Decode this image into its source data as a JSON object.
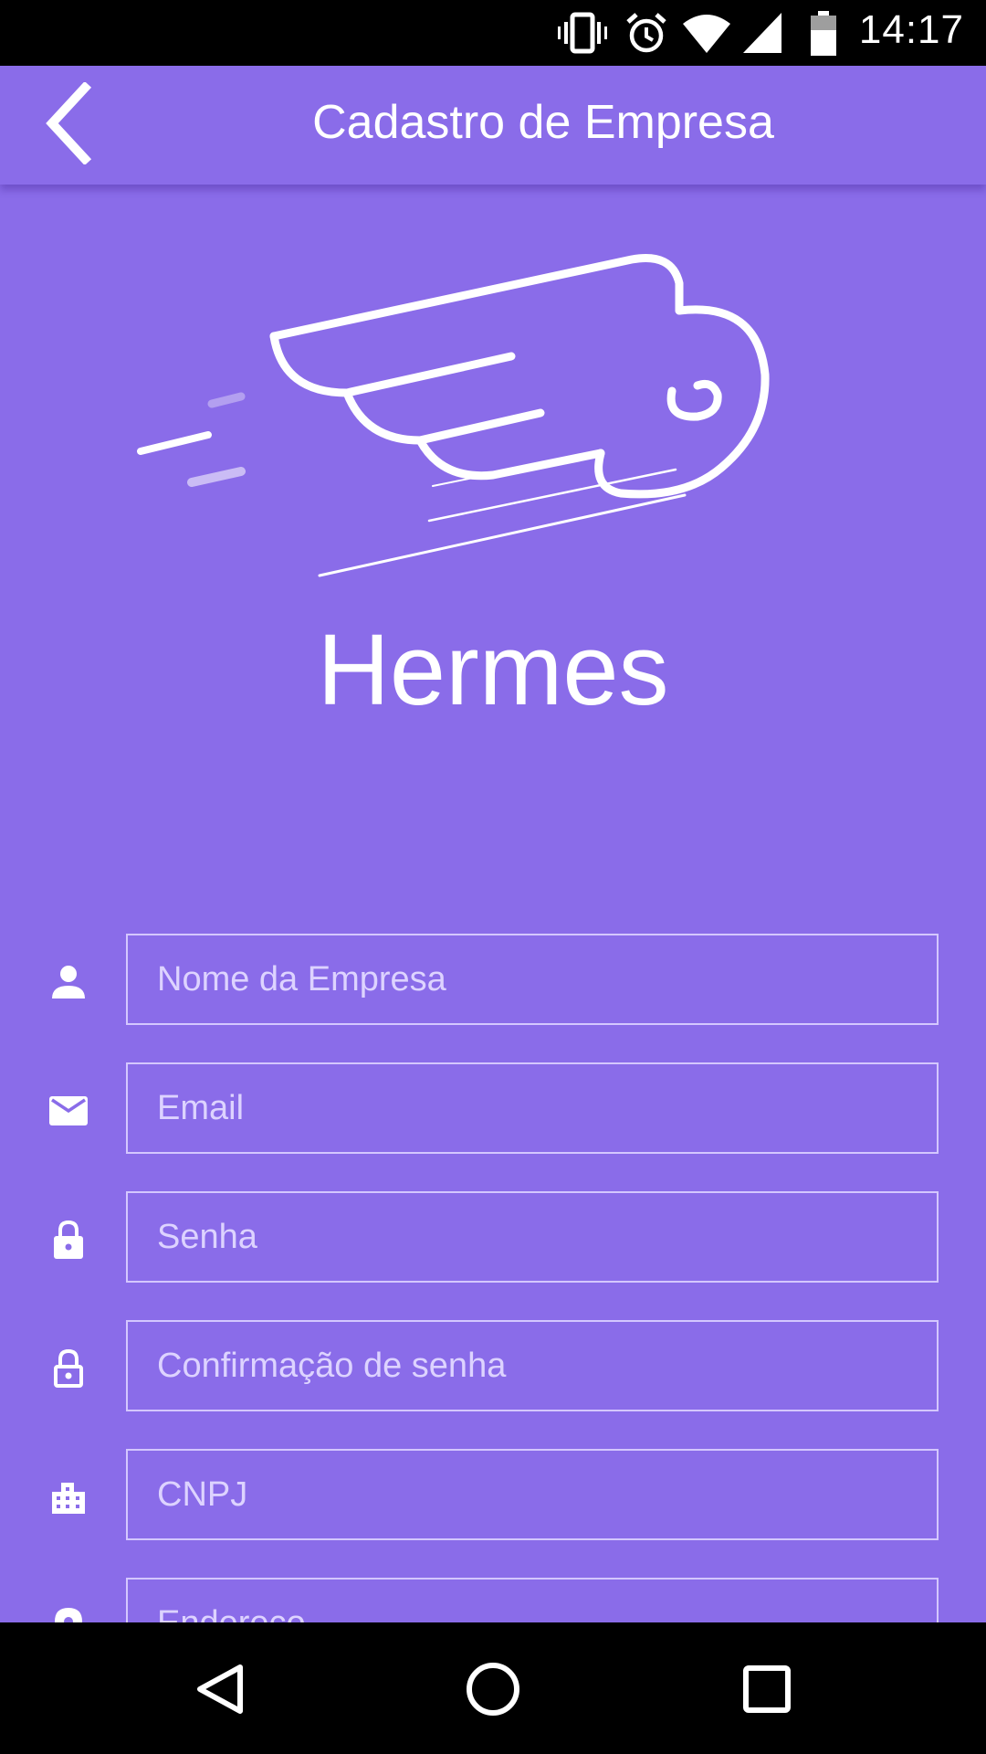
{
  "status_bar": {
    "time": "14:17",
    "icons": [
      "vibrate-icon",
      "alarm-icon",
      "wifi-icon",
      "signal-icon",
      "battery-icon"
    ]
  },
  "app_bar": {
    "title": "Cadastro de Empresa",
    "back_icon": "arrow-back-icon"
  },
  "brand": {
    "name": "Hermes",
    "logo": "winged-logo"
  },
  "form": {
    "fields": [
      {
        "icon": "person-icon",
        "placeholder": "Nome da Empresa",
        "value": ""
      },
      {
        "icon": "mail-icon",
        "placeholder": "Email",
        "value": ""
      },
      {
        "icon": "lock-icon",
        "placeholder": "Senha",
        "value": ""
      },
      {
        "icon": "lock-open-icon",
        "placeholder": "Confirmação de senha",
        "value": ""
      },
      {
        "icon": "building-icon",
        "placeholder": "CNPJ",
        "value": ""
      },
      {
        "icon": "location-pin-icon",
        "placeholder": "Endereço",
        "value": ""
      }
    ]
  },
  "nav_bar": {
    "buttons": [
      "back-triangle-icon",
      "home-circle-icon",
      "recents-square-icon"
    ]
  },
  "colors": {
    "primary": "#8a6ce9",
    "field_border": "#d4c7ff",
    "placeholder": "#ddd3ff",
    "text": "#ffffff",
    "system_bars": "#000000"
  }
}
